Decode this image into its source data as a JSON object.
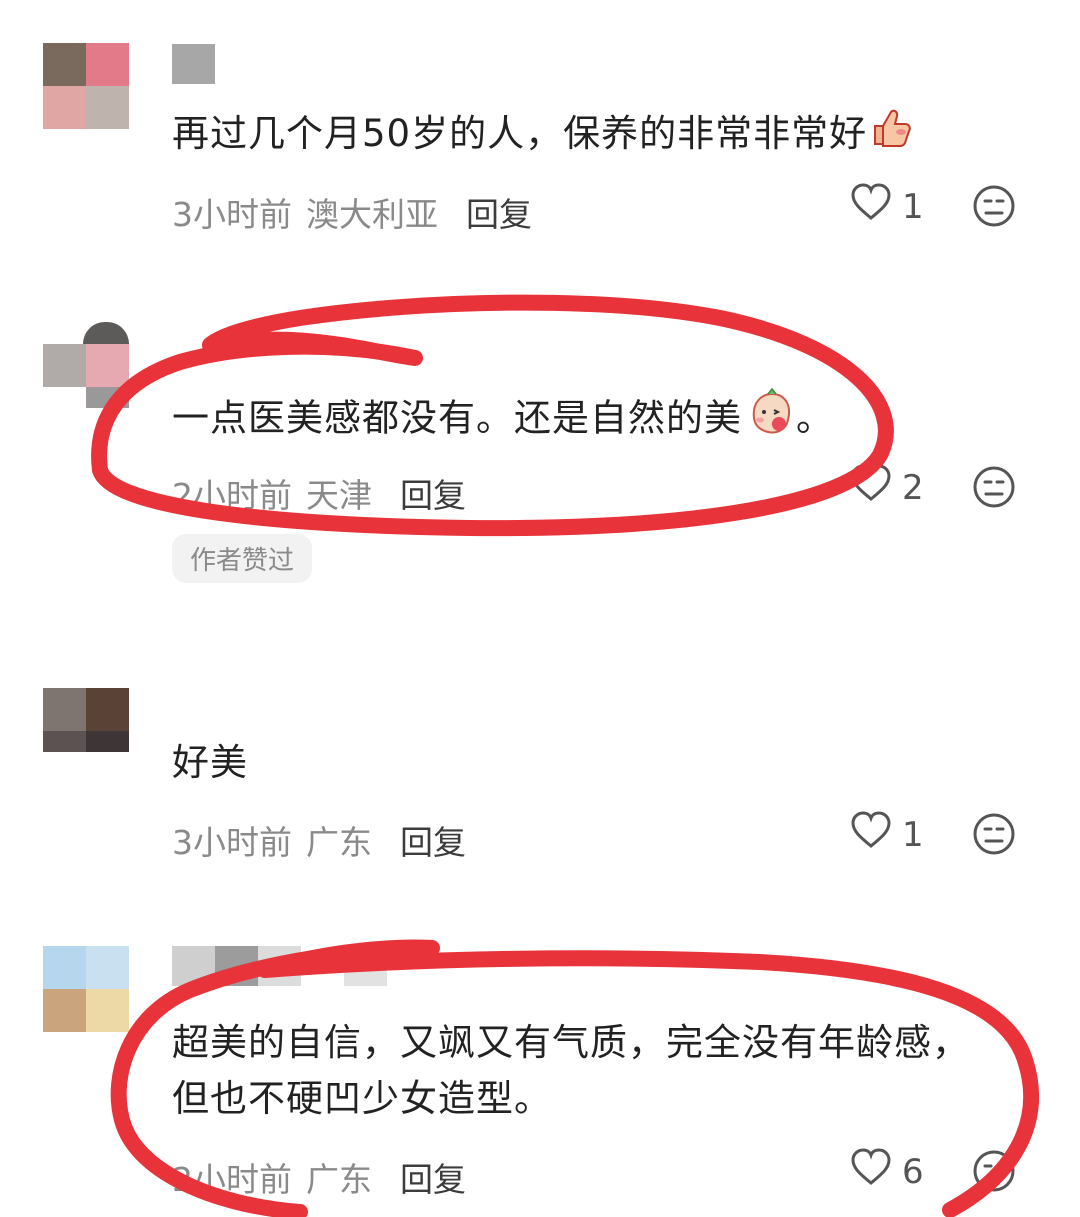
{
  "comments": [
    {
      "text": "再过几个月50岁的人，保养的非常非常好",
      "emoji": "thumbs-up-emoji",
      "time": "3小时前",
      "location": "澳大利亚",
      "reply_label": "回复",
      "likes": "1"
    },
    {
      "text": "一点医美感都没有。还是自然的美",
      "emoji": "blowing-kiss-sticker",
      "trailing": "。",
      "time": "2小时前",
      "location": "天津",
      "reply_label": "回复",
      "likes": "2",
      "badge": "作者赞过"
    },
    {
      "text": "好美",
      "time": "3小时前",
      "location": "广东",
      "reply_label": "回复",
      "likes": "1"
    },
    {
      "text": "超美的自信，又飒又有气质，完全没有年龄感，但也不硬凹少女造型。",
      "time": "2小时前",
      "location": "广东",
      "reply_label": "回复",
      "likes": "6"
    }
  ],
  "icons": {
    "like": "heart-outline-icon",
    "dislike": "neutral-face-icon"
  },
  "colors": {
    "annotation_ink": "#e8333a",
    "meta_gray": "#8a8a8a"
  }
}
